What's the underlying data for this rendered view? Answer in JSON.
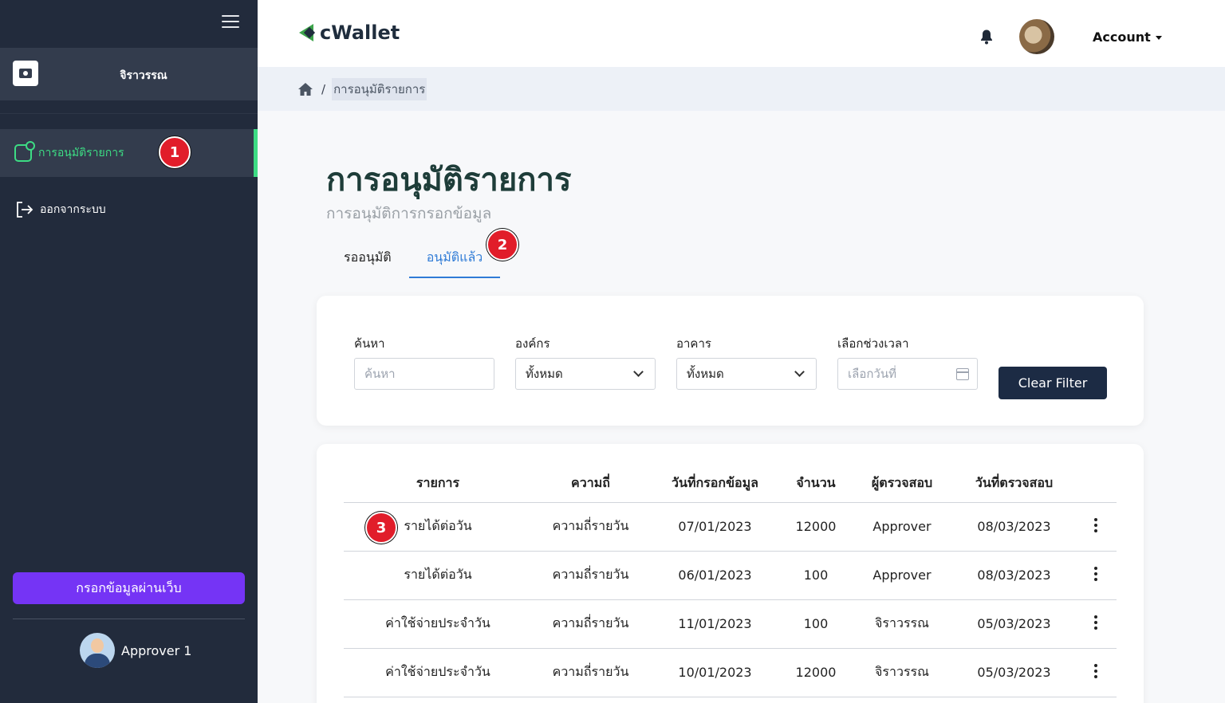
{
  "sidebar": {
    "user_name": "จิราวรรณ",
    "nav": [
      {
        "label": "การอนุมัติรายการ",
        "badge": "1"
      },
      {
        "label": "ออกจากระบบ"
      }
    ],
    "cta_label": "กรอกข้อมูลผ่านเว็บ",
    "profile_name": "Approver 1"
  },
  "header": {
    "logo_text": "cWallet",
    "account_label": "Account"
  },
  "breadcrumb": {
    "current": "การอนุมัติรายการ",
    "separator": "/"
  },
  "page": {
    "title": "การอนุมัติรายการ",
    "subtitle": "การอนุมัติการกรอกข้อมูล",
    "tabs": [
      {
        "label": "รออนุมัติ",
        "active": false
      },
      {
        "label": "อนุมัติแล้ว",
        "active": true,
        "badge": "2"
      }
    ]
  },
  "filters": {
    "search": {
      "label": "ค้นหา",
      "placeholder": "ค้นหา"
    },
    "org": {
      "label": "องค์กร",
      "value": "ทั้งหมด"
    },
    "building": {
      "label": "อาคาร",
      "value": "ทั้งหมด"
    },
    "date": {
      "label": "เลือกช่วงเวลา",
      "placeholder": "เลือกวันที่"
    },
    "clear_label": "Clear Filter"
  },
  "table": {
    "headers": [
      "รายการ",
      "ความถี่",
      "วันที่กรอกข้อมูล",
      "จำนวน",
      "ผู้ตรวจสอบ",
      "วันที่ตรวจสอบ"
    ],
    "rows": [
      {
        "item": "รายได้ต่อวัน",
        "freq": "ความถี่รายวัน",
        "date": "07/01/2023",
        "amount": "12000",
        "reviewer": "Approver",
        "review_date": "08/03/2023",
        "badge": "3"
      },
      {
        "item": "รายได้ต่อวัน",
        "freq": "ความถี่รายวัน",
        "date": "06/01/2023",
        "amount": "100",
        "reviewer": "Approver",
        "review_date": "08/03/2023"
      },
      {
        "item": "ค่าใช้จ่ายประจำวัน",
        "freq": "ความถี่รายวัน",
        "date": "11/01/2023",
        "amount": "100",
        "reviewer": "จิราวรรณ",
        "review_date": "05/03/2023"
      },
      {
        "item": "ค่าใช้จ่ายประจำวัน",
        "freq": "ความถี่รายวัน",
        "date": "10/01/2023",
        "amount": "12000",
        "reviewer": "จิราวรรณ",
        "review_date": "05/03/2023"
      }
    ]
  },
  "colors": {
    "sidebar_bg": "#222b3c",
    "accent_green": "#3ddc84",
    "cta_purple": "#7534f5",
    "tab_blue": "#2f7bd6",
    "badge_red": "#e11d2a"
  }
}
